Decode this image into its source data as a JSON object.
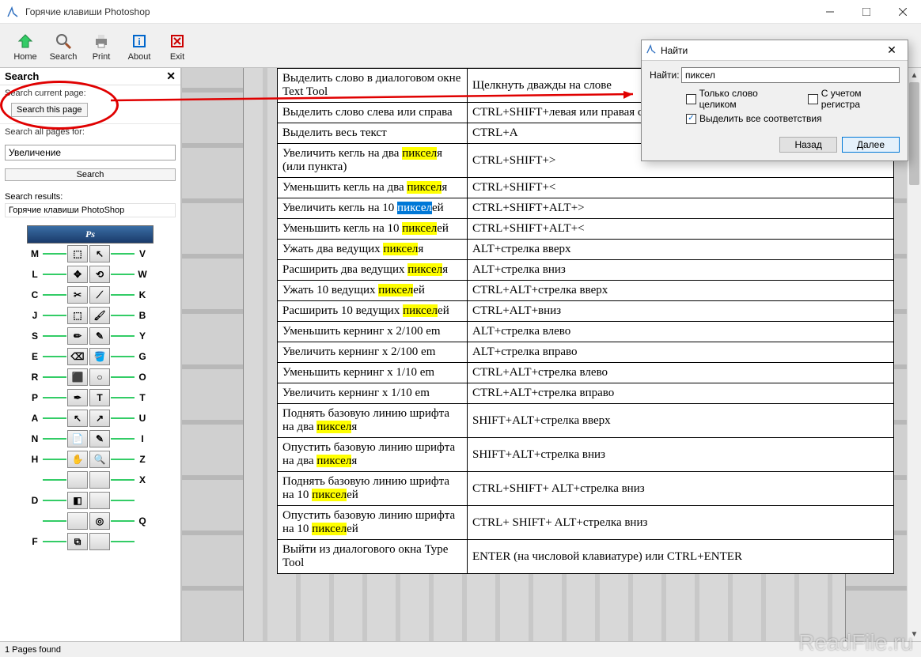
{
  "window": {
    "title": "Горячие клавиши Photoshop"
  },
  "toolbar": {
    "home": "Home",
    "search": "Search",
    "print": "Print",
    "about": "About",
    "exit": "Exit"
  },
  "sidebar": {
    "panel_title": "Search",
    "search_current_label": "Search current page:",
    "search_this_page_btn": "Search this page",
    "search_all_label": "Search all pages for:",
    "search_value": "Увеличение",
    "search_btn": "Search",
    "results_label": "Search results:",
    "result_item": "Горячие клавиши PhotoShop"
  },
  "preview": {
    "ps_label": "Ps",
    "left_keys": [
      "M",
      "L",
      "C",
      "J",
      "S",
      "E",
      "R",
      "P",
      "A",
      "N",
      "H",
      "",
      "D",
      "",
      "F"
    ],
    "right_keys": [
      "V",
      "W",
      "K",
      "B",
      "Y",
      "G",
      "O",
      "T",
      "U",
      "I",
      "Z",
      "X",
      "",
      "Q",
      ""
    ]
  },
  "table_rows": [
    {
      "desc": [
        [
          "Выделить слово в диалоговом окне Text Tool",
          ""
        ]
      ],
      "key": "Щелкнуть дважды на слове"
    },
    {
      "desc": [
        [
          "Выделить слово слева или справа",
          ""
        ]
      ],
      "key": "CTRL+SHIFT+левая или правая стрелка"
    },
    {
      "desc": [
        [
          "Выделить весь текст",
          ""
        ]
      ],
      "key": "CTRL+A"
    },
    {
      "desc": [
        [
          "Увеличить кегль на два ",
          ""
        ],
        [
          "пиксел",
          "hl"
        ],
        [
          "я (или пункта)",
          ""
        ]
      ],
      "key": "CTRL+SHIFT+>"
    },
    {
      "desc": [
        [
          "Уменьшить кегль на два ",
          ""
        ],
        [
          "пиксел",
          "hl"
        ],
        [
          "я",
          ""
        ]
      ],
      "key": "CTRL+SHIFT+<"
    },
    {
      "desc": [
        [
          "Увеличить кегль на 10 ",
          ""
        ],
        [
          "пиксел",
          "sel"
        ],
        [
          "ей",
          ""
        ]
      ],
      "key": "CTRL+SHIFT+ALT+>"
    },
    {
      "desc": [
        [
          "Уменьшить кегль на 10 ",
          ""
        ],
        [
          "пиксел",
          "hl"
        ],
        [
          "ей",
          ""
        ]
      ],
      "key": "CTRL+SHIFT+ALT+<"
    },
    {
      "desc": [
        [
          "Ужать два ведущих ",
          ""
        ],
        [
          "пиксел",
          "hl"
        ],
        [
          "я",
          ""
        ]
      ],
      "key": "ALT+стрелка вверх"
    },
    {
      "desc": [
        [
          "Расширить два ведущих ",
          ""
        ],
        [
          "пиксел",
          "hl"
        ],
        [
          "я",
          ""
        ]
      ],
      "key": "ALT+стрелка вниз"
    },
    {
      "desc": [
        [
          "Ужать 10 ведущих ",
          ""
        ],
        [
          "пиксел",
          "hl"
        ],
        [
          "ей",
          ""
        ]
      ],
      "key": "CTRL+ALT+стрелка вверх"
    },
    {
      "desc": [
        [
          "Расширить 10 ведущих ",
          ""
        ],
        [
          "пиксел",
          "hl"
        ],
        [
          "ей",
          ""
        ]
      ],
      "key": "CTRL+ALT+вниз"
    },
    {
      "desc": [
        [
          "Уменьшить кернинг x 2/100 em",
          ""
        ]
      ],
      "key": "ALT+стрелка влево"
    },
    {
      "desc": [
        [
          "Увеличить кернинг x 2/100 em",
          ""
        ]
      ],
      "key": "ALT+стрелка вправо"
    },
    {
      "desc": [
        [
          "Уменьшить кернинг x 1/10 em",
          ""
        ]
      ],
      "key": "CTRL+ALT+стрелка влево"
    },
    {
      "desc": [
        [
          "Увеличить кернинг x 1/10 em",
          ""
        ]
      ],
      "key": "CTRL+ALT+стрелка вправо"
    },
    {
      "desc": [
        [
          "Поднять базовую линию шрифта на два ",
          ""
        ],
        [
          "пиксел",
          "hl"
        ],
        [
          "я",
          ""
        ]
      ],
      "key": "SHIFT+ALT+стрелка вверх"
    },
    {
      "desc": [
        [
          "Опустить базовую линию шрифта на два ",
          ""
        ],
        [
          "пиксел",
          "hl"
        ],
        [
          "я",
          ""
        ]
      ],
      "key": "SHIFT+ALT+стрелка вниз"
    },
    {
      "desc": [
        [
          "Поднять базовую линию шрифта на 10 ",
          ""
        ],
        [
          "пиксел",
          "hl"
        ],
        [
          "ей",
          ""
        ]
      ],
      "key": "CTRL+SHIFT+ ALT+стрелка вниз"
    },
    {
      "desc": [
        [
          "Опустить базовую линию шрифта на 10 ",
          ""
        ],
        [
          "пиксел",
          "hl"
        ],
        [
          "ей",
          ""
        ]
      ],
      "key": "CTRL+ SHIFT+ ALT+стрелка вниз"
    },
    {
      "desc": [
        [
          "Выйти из диалогового окна Type Tool",
          ""
        ]
      ],
      "key": "ENTER (на числовой клавиатуре) или CTRL+ENTER"
    }
  ],
  "find_dialog": {
    "title": "Найти",
    "label": "Найти:",
    "value": "пиксел",
    "whole_word": "Только слово целиком",
    "match_case": "С учетом регистра",
    "highlight_all": "Выделить все соответствия",
    "back": "Назад",
    "next": "Далее"
  },
  "status": {
    "text": "1 Pages found"
  },
  "watermark": "ReadFile.ru"
}
